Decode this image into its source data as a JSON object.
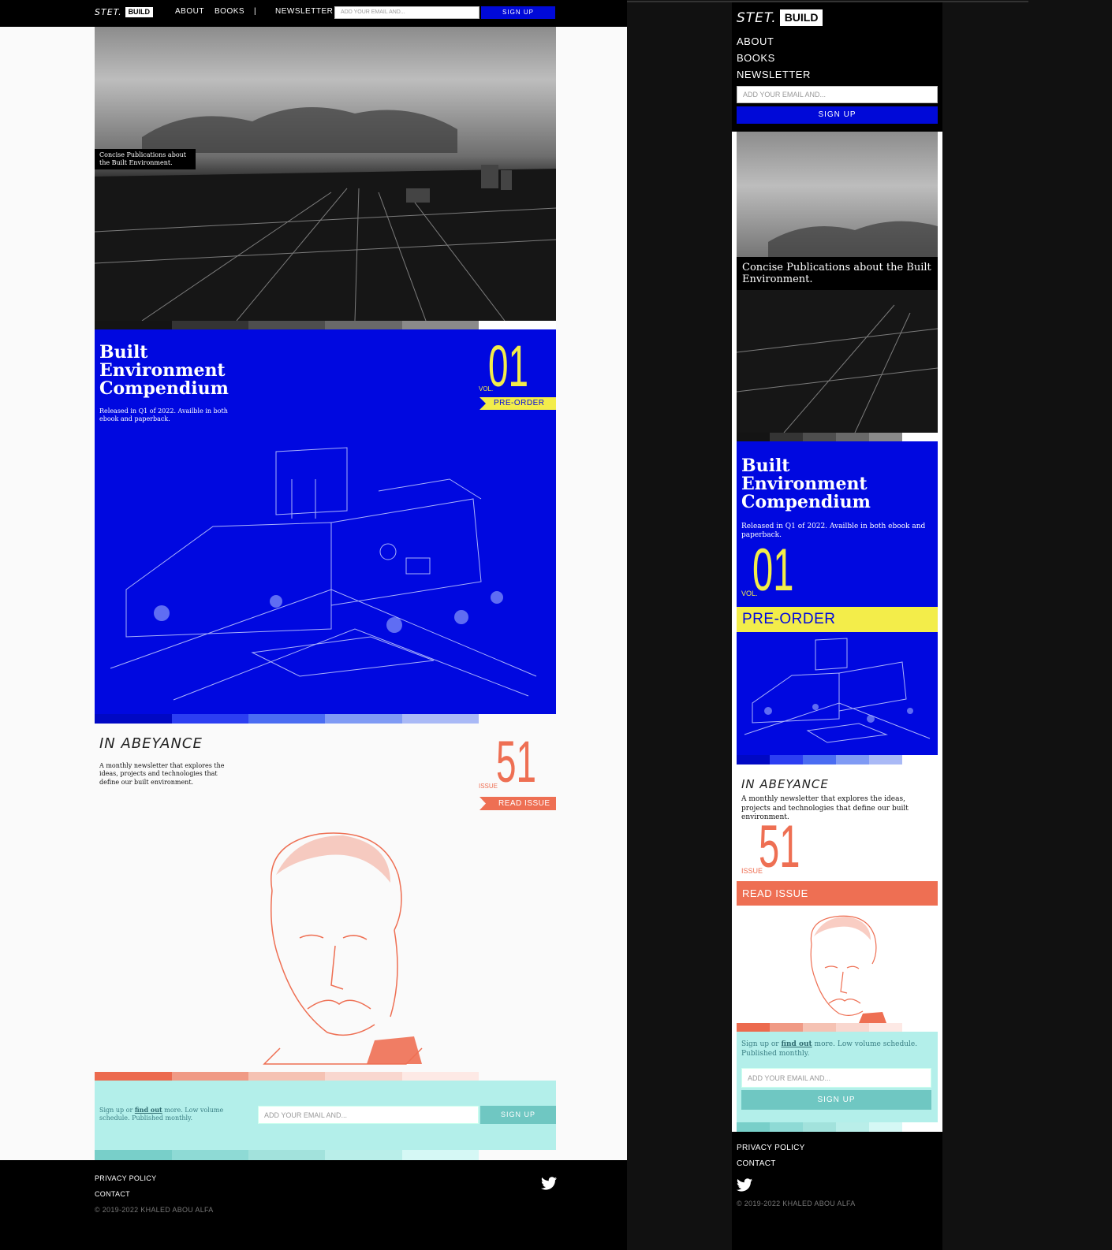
{
  "brand": {
    "stet": "STET.",
    "build": "BUILD"
  },
  "nav": {
    "about": "ABOUT",
    "books": "BOOKS",
    "sep": "|",
    "newsletter": "NEWSLETTER"
  },
  "signup": {
    "placeholder": "ADD YOUR EMAIL AND...",
    "button": "SIGN UP"
  },
  "hero": {
    "tagline": "Concise Publications about the Built Environment."
  },
  "book": {
    "title_line1": "Built",
    "title_line2": "Environment",
    "title_line3": "Compendium",
    "description": "Released in Q1 of 2022. Availble in both ebook and paperback.",
    "vol_label": "VOL.",
    "vol_number": "01",
    "cta": "PRE-ORDER"
  },
  "newsletter": {
    "title": "IN ABEYANCE",
    "description": "A monthly newsletter that explores the ideas, projects and technologies that define our built environment.",
    "issue_label": "ISSUE",
    "issue_number": "51",
    "cta": "READ ISSUE"
  },
  "subscribe": {
    "text_before": "Sign up or ",
    "link": "find out",
    "text_after": " more. Low volume schedule. Published monthly.",
    "placeholder": "ADD YOUR EMAIL AND...",
    "button": "SIGN UP"
  },
  "footer": {
    "privacy": "PRIVACY POLICY",
    "contact": "CONTACT",
    "copyright": "© 2019-2022 KHALED ABOU ALFA",
    "twitter_icon": "twitter-icon"
  },
  "colors": {
    "blue": "#0008e0",
    "yellow": "#f3ed4a",
    "coral": "#ee6f53",
    "mint": "#b3efea",
    "teal": "#6fc7c2"
  }
}
